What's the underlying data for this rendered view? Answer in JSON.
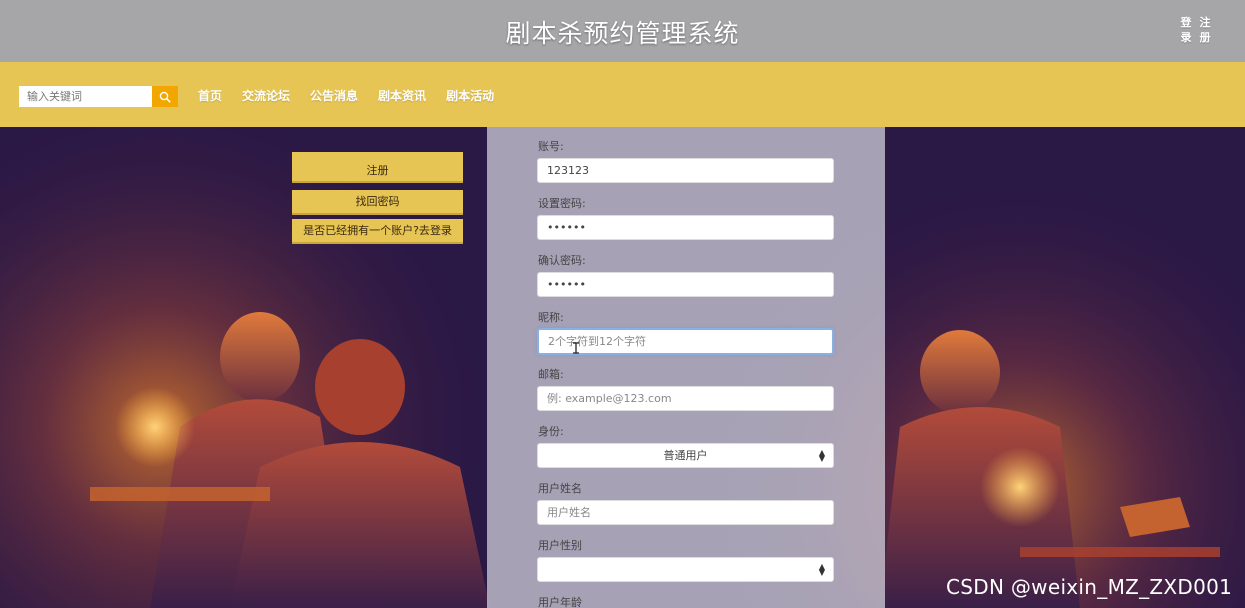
{
  "header": {
    "title": "剧本杀预约管理系统",
    "login_label": "登录",
    "register_label": "注册"
  },
  "nav": {
    "search_placeholder": "输入关键词",
    "links": [
      "首页",
      "交流论坛",
      "公告消息",
      "剧本资讯",
      "剧本活动"
    ]
  },
  "side_buttons": {
    "register": "注册",
    "forgot_password": "找回密码",
    "have_account": "是否已经拥有一个账户?去登录"
  },
  "form": {
    "account": {
      "label": "账号:",
      "value": "123123"
    },
    "password": {
      "label": "设置密码:",
      "value": "••••••"
    },
    "confirm_password": {
      "label": "确认密码:",
      "value": "••••••"
    },
    "nickname": {
      "label": "昵称:",
      "placeholder": "2个字符到12个字符"
    },
    "email": {
      "label": "邮箱:",
      "placeholder": "例: example@123.com"
    },
    "identity": {
      "label": "身份:",
      "selected": "普通用户"
    },
    "real_name": {
      "label": "用户姓名",
      "placeholder": "用户姓名"
    },
    "gender": {
      "label": "用户性别",
      "selected": ""
    },
    "age": {
      "label": "用户年龄"
    }
  },
  "watermark": "CSDN @weixin_MZ_ZXD001",
  "colors": {
    "header_gray": "#a6a6a8",
    "nav_yellow": "#e6c554",
    "search_orange": "#f2a600"
  }
}
